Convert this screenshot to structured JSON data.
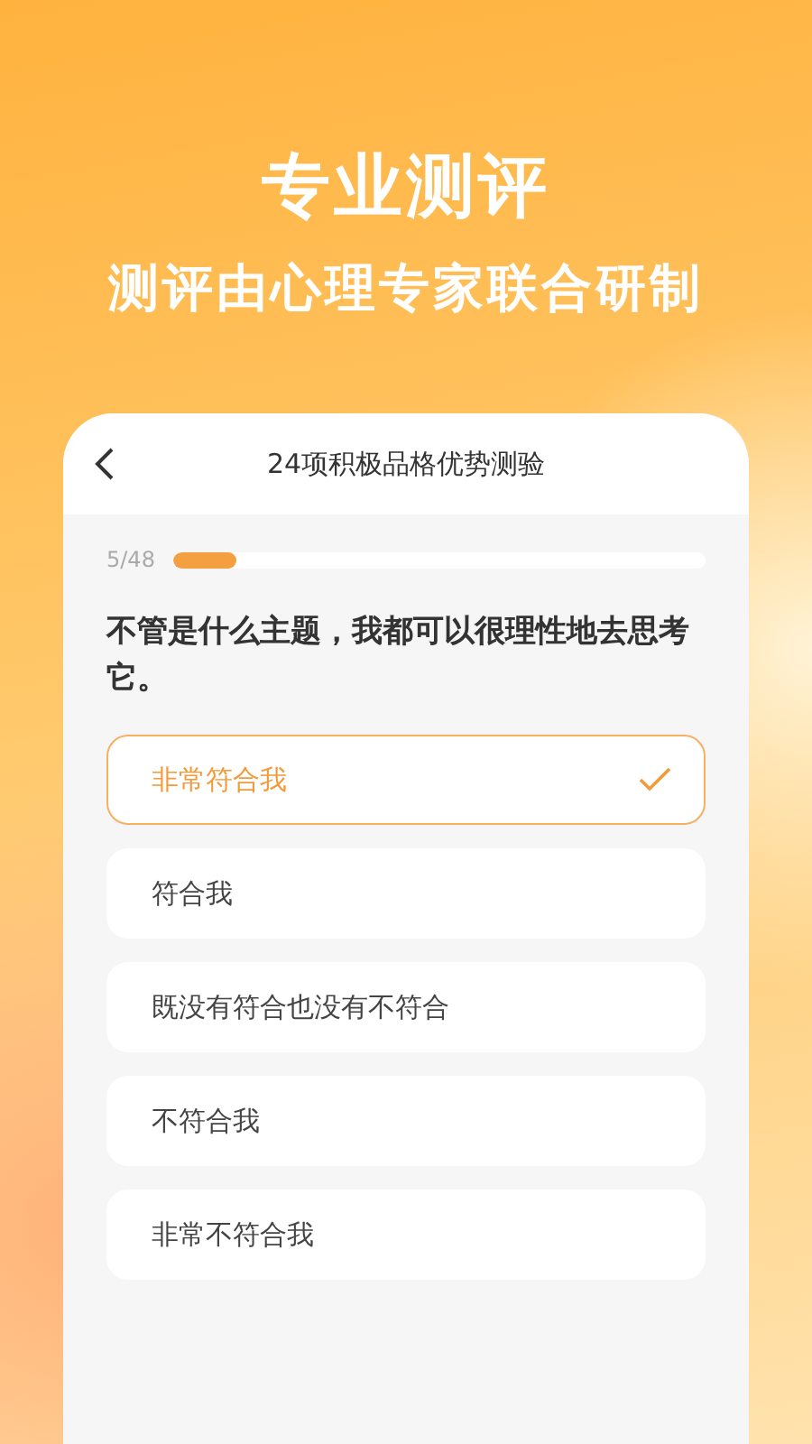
{
  "banner": {
    "title": "专业测评",
    "subtitle": "测评由心理专家联合研制"
  },
  "quiz": {
    "title": "24项积极品格优势测验",
    "progress": {
      "count": "5/48",
      "level": 0.12
    },
    "question": "不管是什么主题，我都可以很理性地去思考它。",
    "options": [
      {
        "label": "非常符合我",
        "selected": true
      },
      {
        "label": "符合我",
        "selected": false
      },
      {
        "label": "既没有符合也没有不符合",
        "selected": false
      },
      {
        "label": "不符合我",
        "selected": false
      },
      {
        "label": "非常不符合我",
        "selected": false
      }
    ]
  }
}
